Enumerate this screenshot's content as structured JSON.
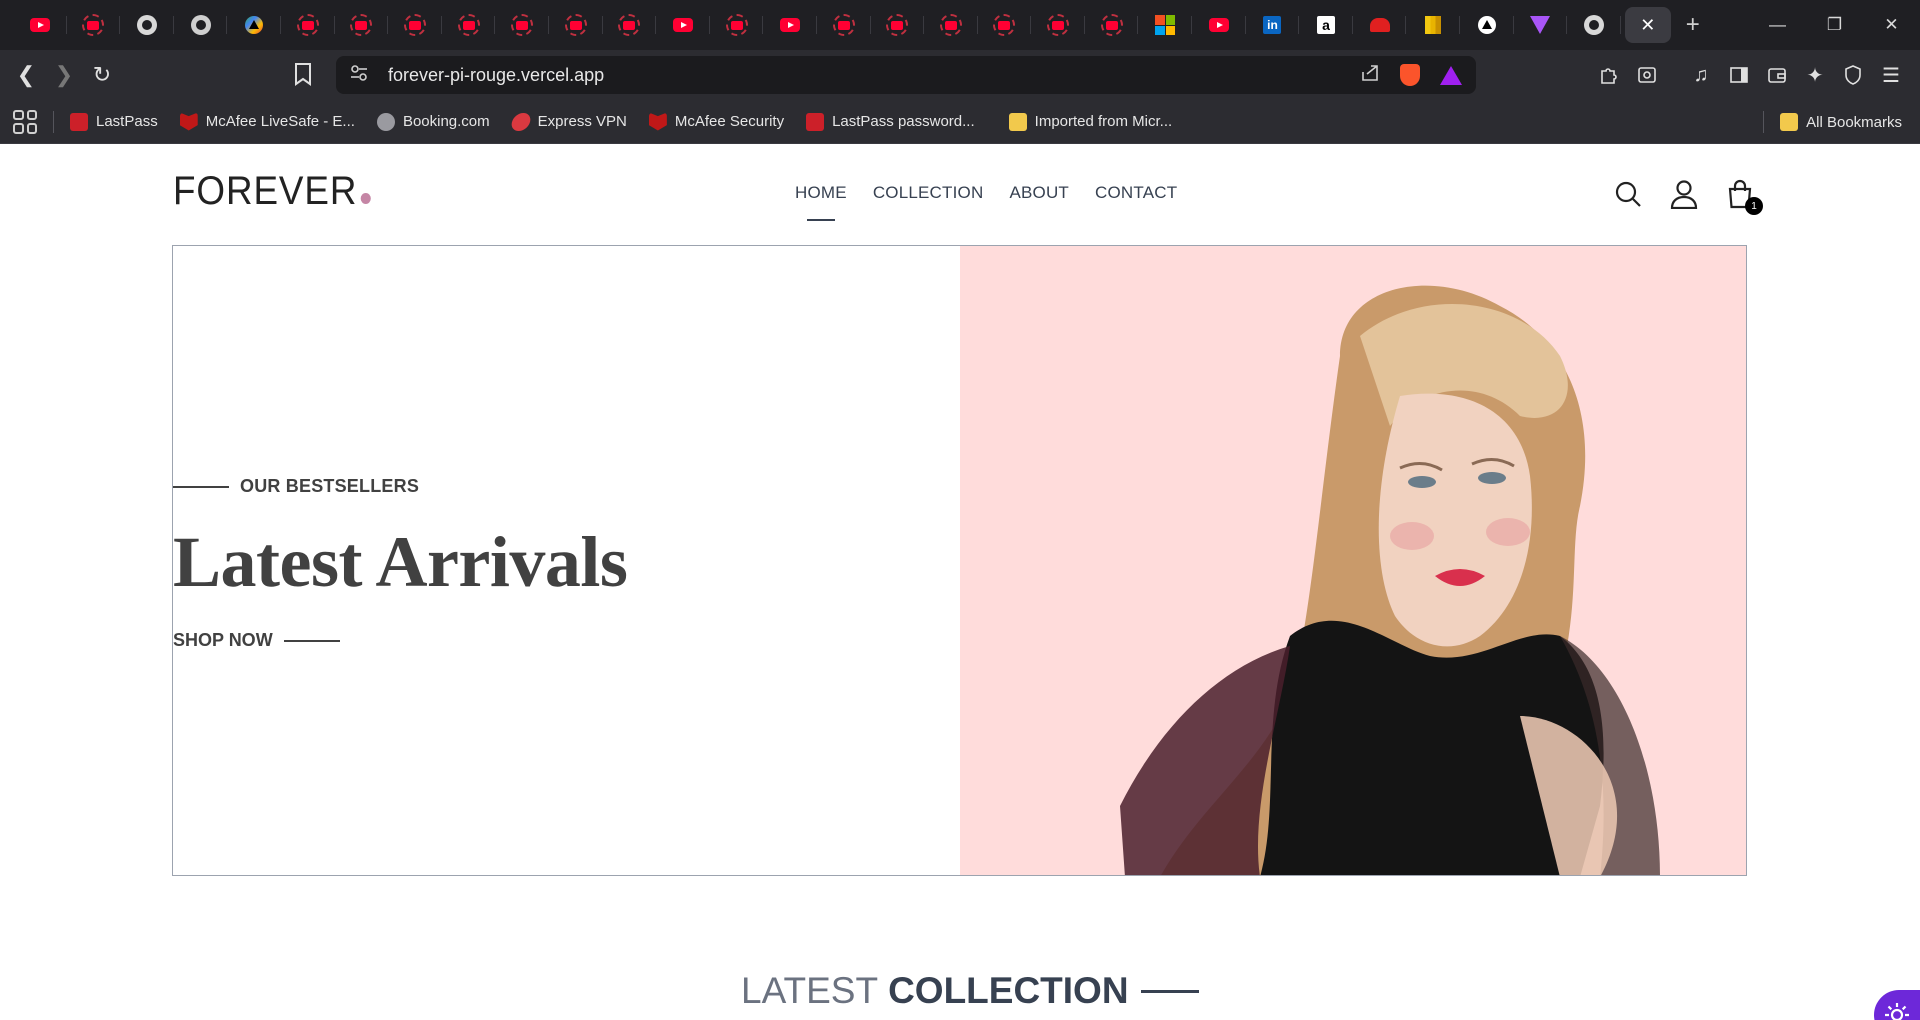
{
  "browser": {
    "tabs_favicons": [
      "youtube",
      "youtube-circle",
      "github",
      "chatgpt",
      "google-play",
      "youtube-circle",
      "youtube-circle",
      "youtube-circle",
      "youtube-circle",
      "youtube-circle",
      "youtube-circle",
      "youtube-circle",
      "youtube",
      "youtube-circle",
      "youtube",
      "youtube-circle",
      "youtube-circle",
      "youtube-circle",
      "youtube-circle",
      "youtube-circle",
      "youtube-circle",
      "microsoft",
      "youtube",
      "linkedin",
      "amazon",
      "red-app",
      "power-bi",
      "triangle-app",
      "vite",
      "github"
    ],
    "active_tab_close": "✕",
    "new_tab": "+",
    "url": "forever-pi-rouge.vercel.app",
    "bookmarks": [
      {
        "label": "LastPass",
        "icon": "lastpass"
      },
      {
        "label": "McAfee LiveSafe - E...",
        "icon": "mcafee"
      },
      {
        "label": "Booking.com",
        "icon": "globe"
      },
      {
        "label": "Express VPN",
        "icon": "expressvpn"
      },
      {
        "label": "McAfee Security",
        "icon": "mcafee"
      },
      {
        "label": "LastPass password...",
        "icon": "lastpass"
      },
      {
        "label": "Imported from Micr...",
        "icon": "folder"
      }
    ],
    "all_bookmarks": "All Bookmarks"
  },
  "site": {
    "logo_text": "FOREVER",
    "nav": [
      "HOME",
      "COLLECTION",
      "ABOUT",
      "CONTACT"
    ],
    "cart_count": "1"
  },
  "hero": {
    "eyebrow": "OUR BESTSELLERS",
    "headline": "Latest Arrivals",
    "cta": "SHOP NOW",
    "image_alt": "model-portrait"
  },
  "section": {
    "title_light": "LATEST",
    "title_bold": "COLLECTION"
  },
  "colors": {
    "accent_dot": "#c586a5",
    "hero_bg": "#ffdcdb",
    "floating_button": "#6d28d9"
  }
}
